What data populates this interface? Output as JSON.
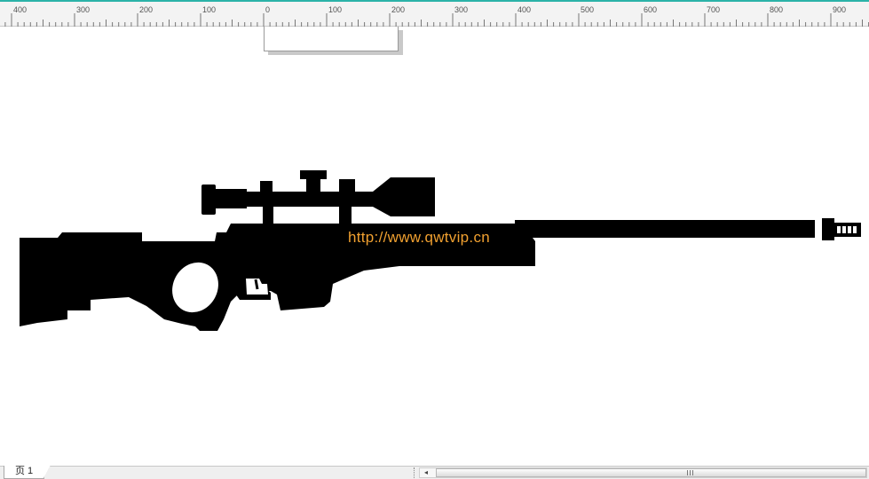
{
  "ruler": {
    "labels": [
      "400",
      "300",
      "200",
      "100",
      "0",
      "100",
      "200",
      "300",
      "400",
      "500",
      "600",
      "700",
      "800",
      "900"
    ]
  },
  "canvas": {
    "watermark": "http://www.qwtvip.cn",
    "artwork_icon": "rifle-silhouette-icon"
  },
  "status": {
    "page_tab": "页 1",
    "scroll_left_icon": "◂",
    "scroll_grip_icon": "|||"
  },
  "colors": {
    "accent_line": "#2bb3a8",
    "watermark": "#f0a030",
    "silhouette": "#000000"
  }
}
